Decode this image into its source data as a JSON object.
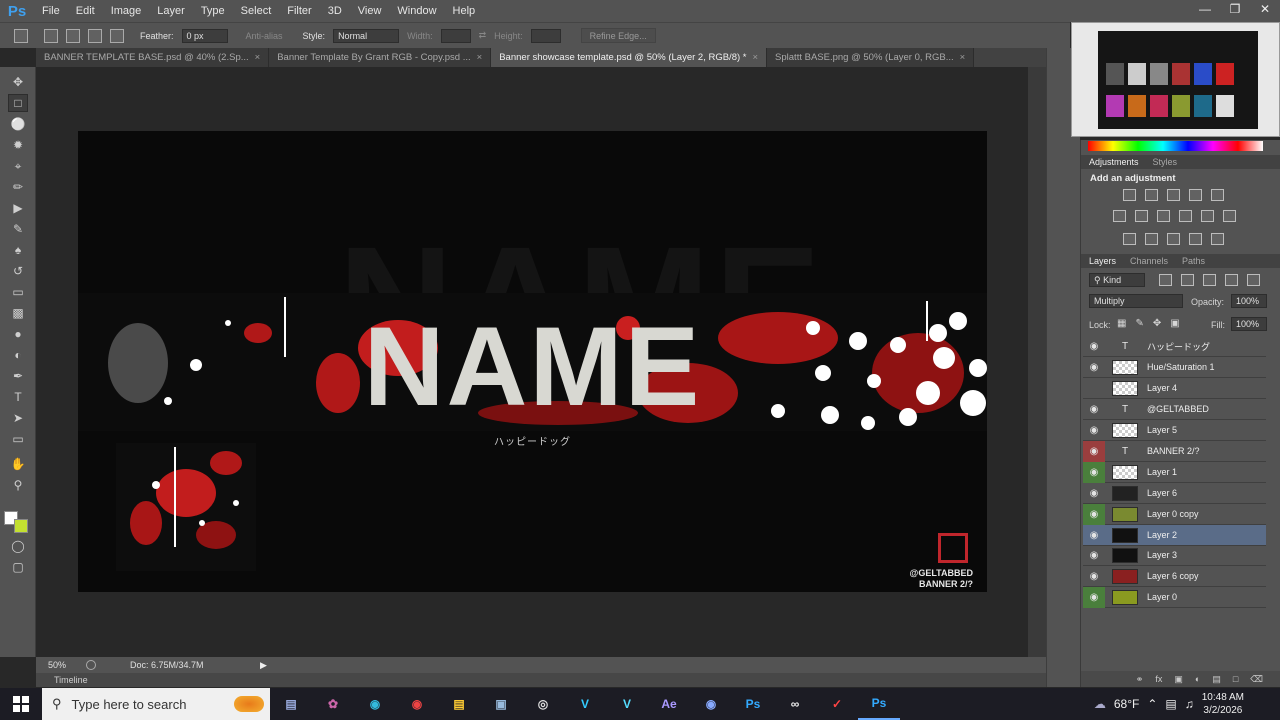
{
  "app": {
    "logo": "Ps"
  },
  "menu": [
    "File",
    "Edit",
    "Image",
    "Layer",
    "Type",
    "Select",
    "Filter",
    "3D",
    "View",
    "Window",
    "Help"
  ],
  "options": {
    "feather_label": "Feather:",
    "feather_value": "0 px",
    "antialias_label": "Anti-alias",
    "style_label": "Style:",
    "style_value": "Normal",
    "width_label": "Width:",
    "height_label": "Height:",
    "refine_label": "Refine Edge..."
  },
  "tabs": [
    {
      "label": "BANNER TEMPLATE BASE.psd @ 40% (2.Sp...",
      "active": false
    },
    {
      "label": "Banner Template By Grant RGB - Copy.psd ...",
      "active": false
    },
    {
      "label": "Banner showcase template.psd @ 50% (Layer 2, RGB/8) *",
      "active": true
    },
    {
      "label": "Splattt BASE.png @ 50% (Layer 0, RGB...",
      "active": false
    }
  ],
  "canvas": {
    "name_text": "NAME",
    "subtitle": "ハッピードッグ",
    "handle": "@GELTABBED",
    "banner_code": "BANNER 2/?"
  },
  "status": {
    "zoom": "50%",
    "doc": "Doc: 6.75M/34.7M"
  },
  "timeline_label": "Timeline",
  "adjustments": {
    "tab_adjustments": "Adjustments",
    "tab_styles": "Styles",
    "add_label": "Add an adjustment"
  },
  "layers_panel": {
    "tab_layers": "Layers",
    "tab_channels": "Channels",
    "tab_paths": "Paths",
    "kind": "Kind",
    "blend": "Multiply",
    "opacity_label": "Opacity:",
    "opacity_value": "100%",
    "lock_label": "Lock:",
    "fill_label": "Fill:",
    "fill_value": "100%"
  },
  "layers": [
    {
      "name": "ハッピードッグ",
      "type": "text",
      "eye": "on"
    },
    {
      "name": "Hue/Saturation 1",
      "type": "pixel",
      "eye": "on"
    },
    {
      "name": "Layer 4",
      "type": "pixel",
      "eye": "off"
    },
    {
      "name": "@GELTABBED",
      "type": "text",
      "eye": "on"
    },
    {
      "name": "Layer 5",
      "type": "pixel",
      "eye": "on"
    },
    {
      "name": "BANNER 2/?",
      "type": "text",
      "eye": "red"
    },
    {
      "name": "Layer 1",
      "type": "pixel",
      "eye": "green"
    },
    {
      "name": "Layer 6",
      "type": "pixel",
      "eye": "on"
    },
    {
      "name": "Layer 0 copy",
      "type": "pixel",
      "eye": "green"
    },
    {
      "name": "Layer 2",
      "type": "pixel",
      "eye": "on",
      "selected": true
    },
    {
      "name": "Layer 3",
      "type": "pixel",
      "eye": "on"
    },
    {
      "name": "Layer 6 copy",
      "type": "pixel",
      "eye": "on"
    },
    {
      "name": "Layer 0",
      "type": "pixel",
      "eye": "green"
    }
  ],
  "taskbar": {
    "search_placeholder": "Type here to search",
    "apps": [
      "V",
      "V",
      "Ae",
      "Ps",
      "Ps"
    ],
    "weather": "68°F",
    "time": "10:48 AM",
    "date": "3/2/2026"
  }
}
